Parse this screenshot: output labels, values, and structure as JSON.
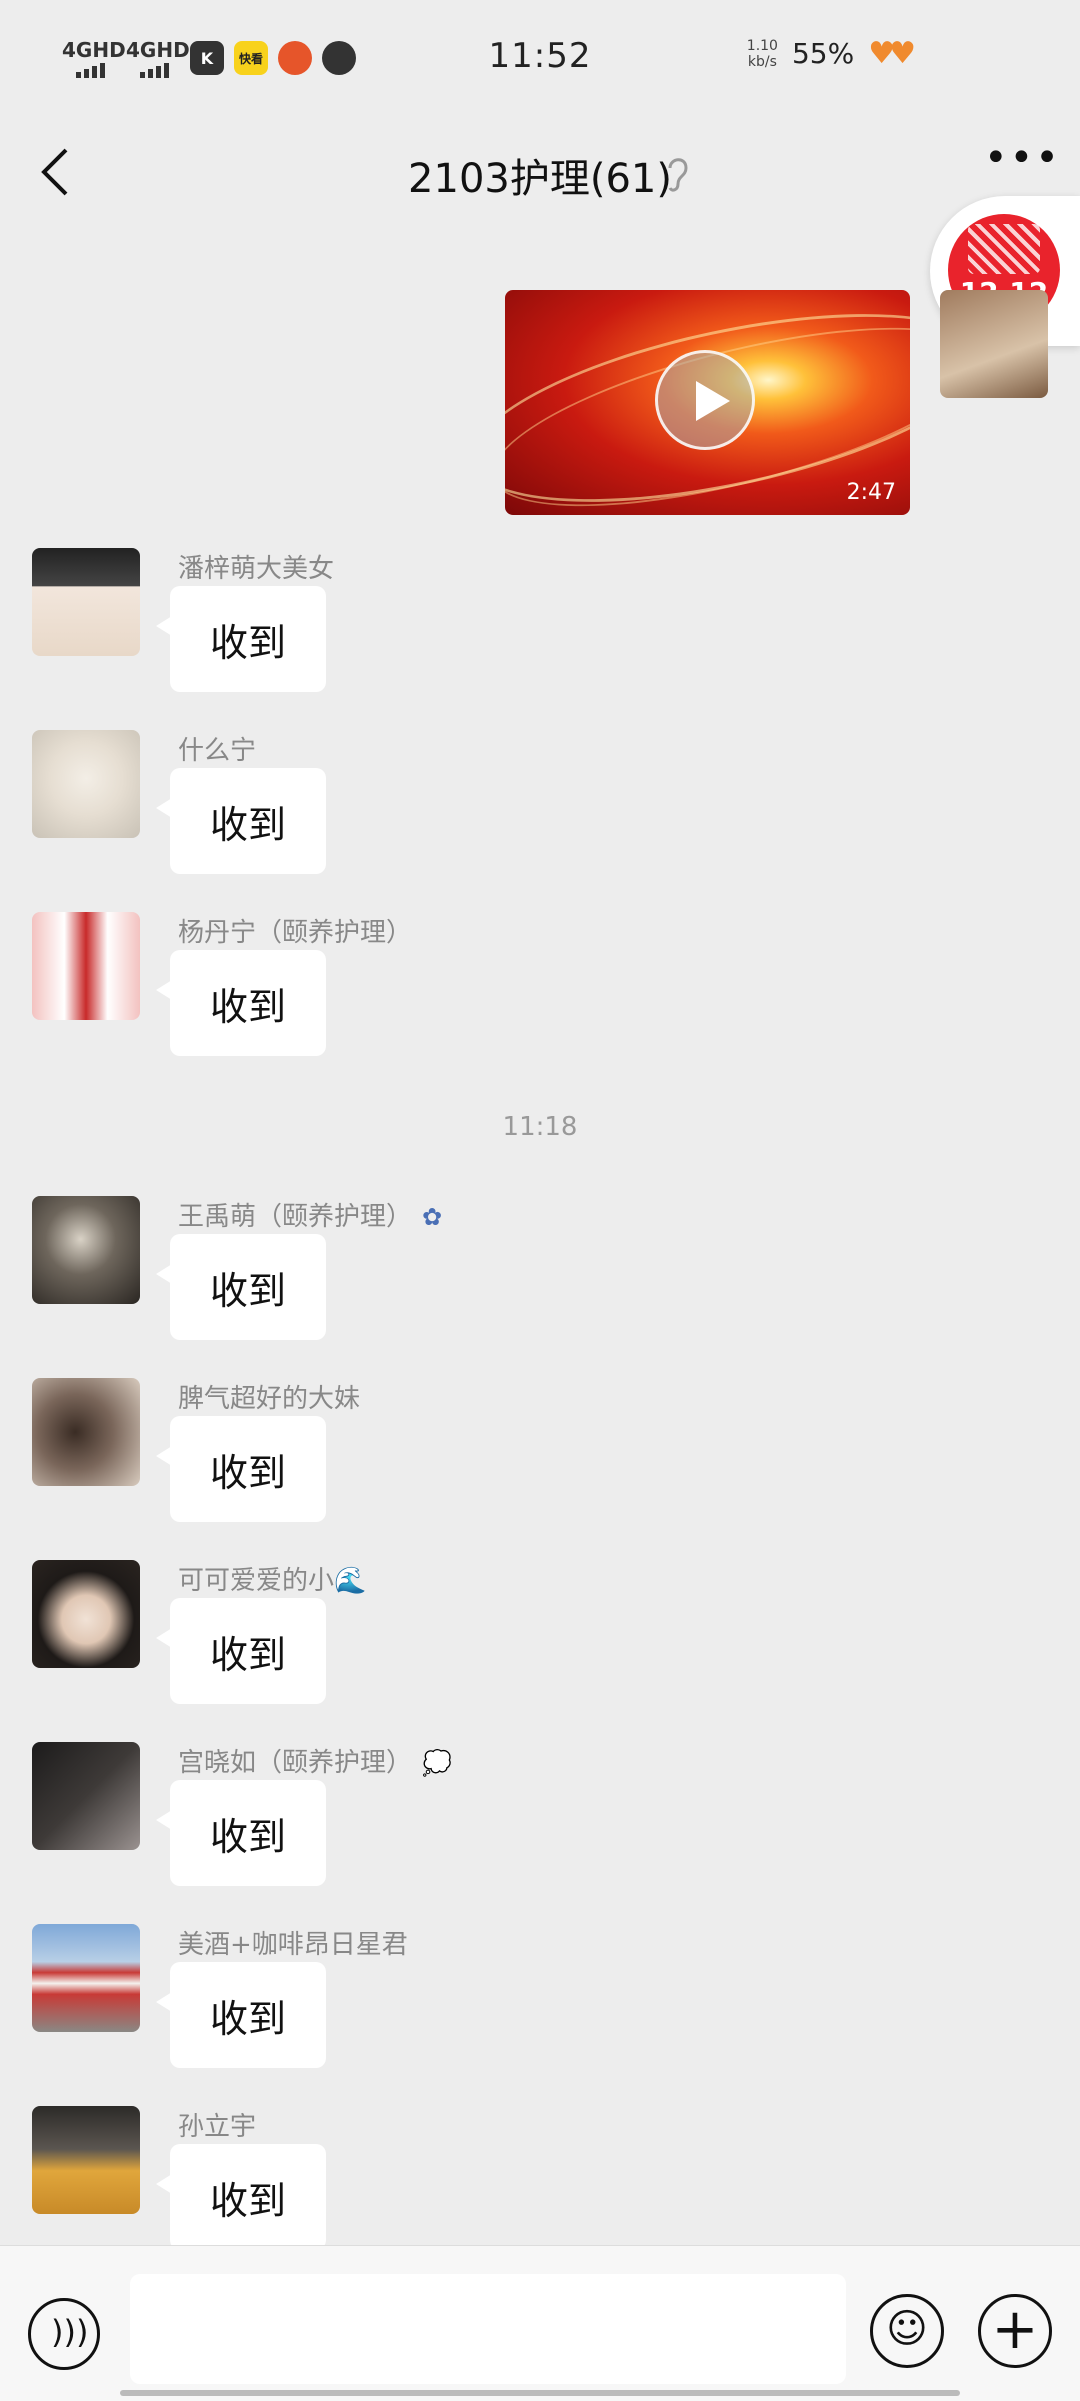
{
  "status_bar": {
    "network1": "4GHD",
    "network2": "4GHD",
    "app_icon1": "K",
    "app_icon2": "快看",
    "time": "11:52",
    "speed_value": "1.10",
    "speed_unit": "kb/s",
    "battery": "55%"
  },
  "header": {
    "title": "2103护理(61)"
  },
  "video": {
    "duration": "2:47"
  },
  "promo": {
    "label": "12.12"
  },
  "time_divider": "11:18",
  "messages": [
    {
      "sender": "潘梓萌大美女",
      "text": "收到"
    },
    {
      "sender": "什么宁",
      "text": "收到"
    },
    {
      "sender": "杨丹宁（颐养护理）",
      "text": "收到"
    },
    {
      "sender": "王禹萌（颐养护理）",
      "text": "收到"
    },
    {
      "sender": "脾气超好的大妹",
      "text": "收到"
    },
    {
      "sender": "可可爱爱的小🌊",
      "text": "收到"
    },
    {
      "sender": "宫晓如（颐养护理）",
      "text": "收到"
    },
    {
      "sender": "美酒+咖啡昂日星君",
      "text": "收到"
    },
    {
      "sender": "孙立宇",
      "text": "收到"
    }
  ],
  "input": {
    "placeholder": ""
  },
  "icons": {
    "back": "back-arrow-icon",
    "ear": "ear-icon",
    "more": "more-icon",
    "voice": "voice-icon",
    "emoji": "emoji-icon",
    "plus": "plus-icon"
  }
}
